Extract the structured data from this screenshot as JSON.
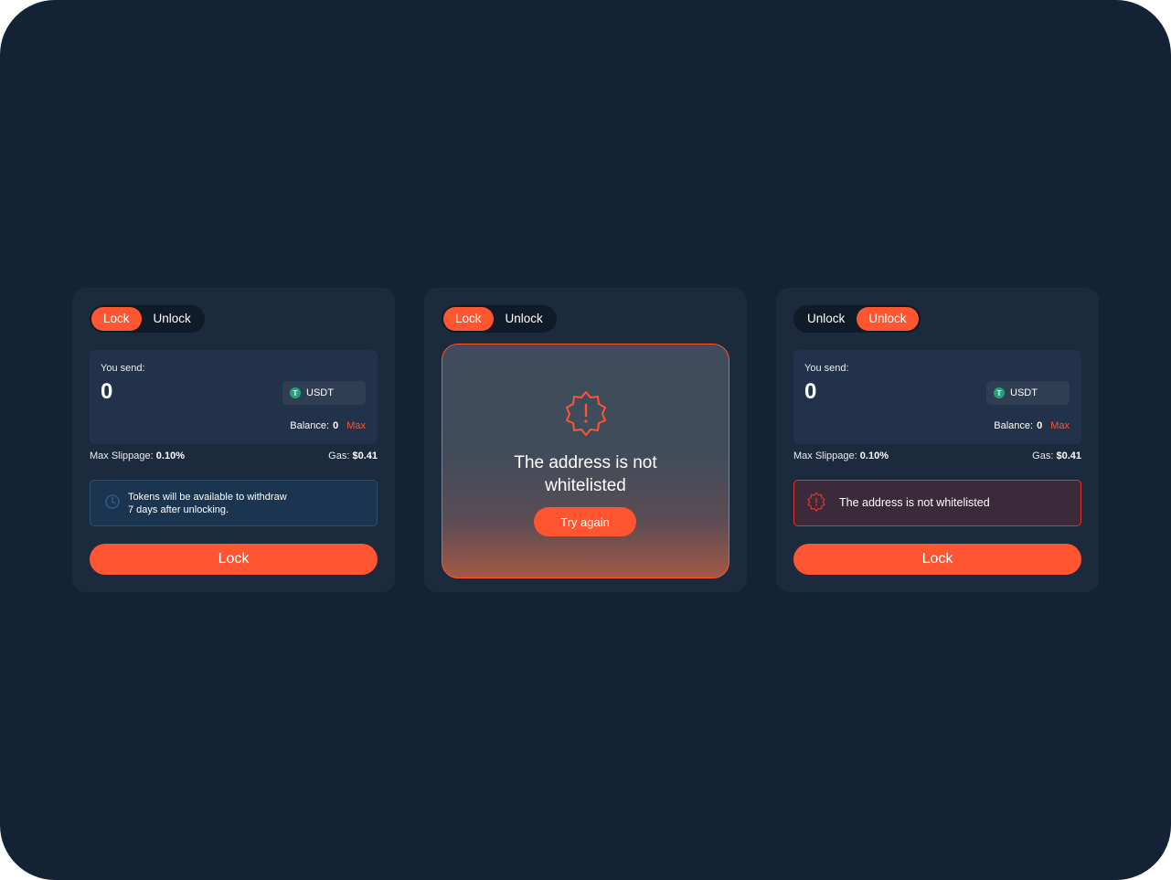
{
  "colors": {
    "accent": "#ff5530",
    "background": "#132235",
    "card": "#1b2a3c",
    "error": "#e2342e"
  },
  "card1": {
    "toggle": [
      "Lock",
      "Unlock"
    ],
    "send_label": "You send:",
    "amount": "0",
    "token": "USDT",
    "token_icon_letter": "T",
    "balance_label": "Balance:",
    "balance_value": "0",
    "max_label": "Max",
    "slippage_label": "Max Slippage:",
    "slippage_value": "0.10%",
    "gas_label": "Gas:",
    "gas_value": "$0.41",
    "notice_line1": "Tokens will be available to withdraw",
    "notice_line2": "7 days after unlocking.",
    "button": "Lock"
  },
  "card2": {
    "toggle": [
      "Lock",
      "Unlock"
    ],
    "error_line1": "The address is not",
    "error_line2": "whitelisted",
    "retry": "Try again"
  },
  "card3": {
    "toggle": [
      "Unlock",
      "Unlock"
    ],
    "send_label": "You send:",
    "amount": "0",
    "token": "USDT",
    "token_icon_letter": "T",
    "balance_label": "Balance:",
    "balance_value": "0",
    "max_label": "Max",
    "slippage_label": "Max Slippage:",
    "slippage_value": "0.10%",
    "gas_label": "Gas:",
    "gas_value": "$0.41",
    "error_text": "The address is not whitelisted",
    "button": "Lock"
  }
}
